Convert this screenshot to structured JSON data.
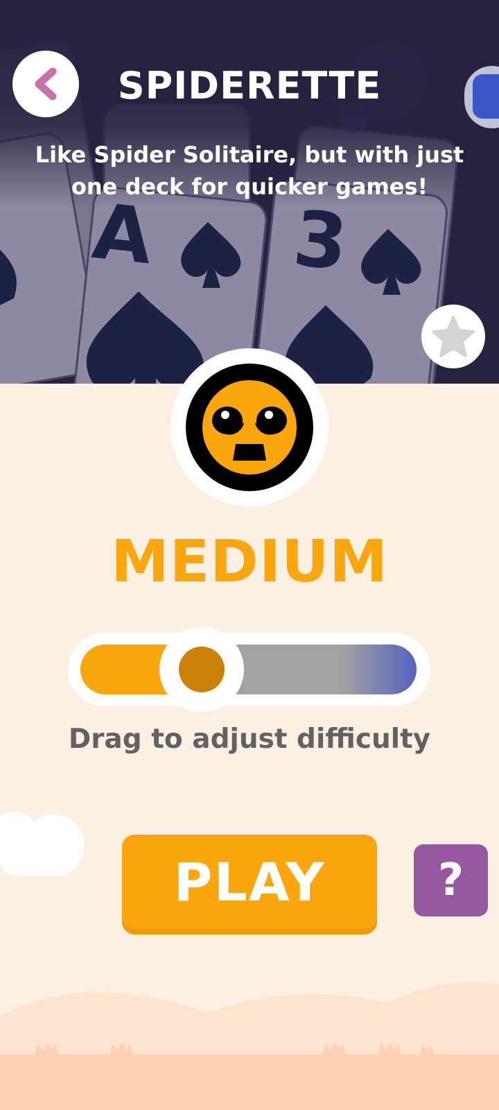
{
  "header": {
    "title": "SPIDERETTE",
    "subtitle": "Like Spider Solitaire, but with just one deck for quicker games!",
    "background_cards": [
      "A",
      "3"
    ],
    "back_icon": "chevron-left-icon",
    "message_icon": "chat-bubble-icon",
    "favorite_icon": "star-icon"
  },
  "difficulty": {
    "label": "MEDIUM",
    "level": 0.33,
    "hint": "Drag to adjust difficulty",
    "avatar_icon": "grumpy-face-icon"
  },
  "actions": {
    "play_label": "PLAY",
    "help_label": "?"
  },
  "colors": {
    "accent_orange": "#fca60f",
    "header_bg": "#27223f",
    "page_bg": "#fbf0e1",
    "help_purple": "#94599e",
    "slider_hard": "#5561bf"
  }
}
